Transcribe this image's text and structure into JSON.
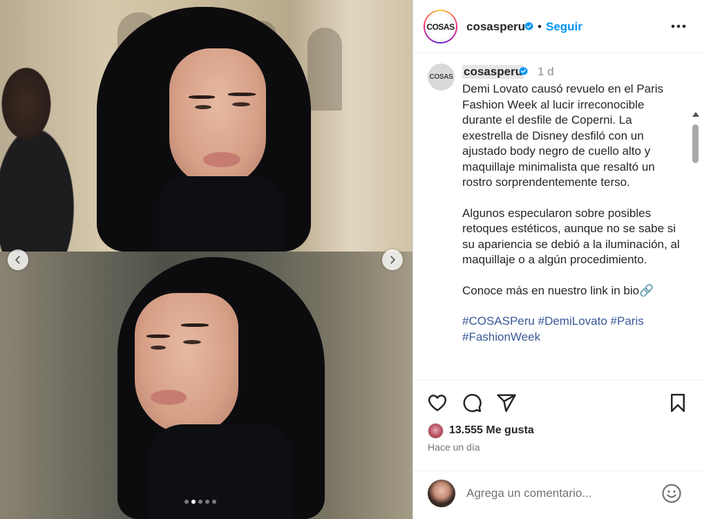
{
  "post": {
    "username": "cosasperu",
    "avatar_text": "COSAS",
    "verified_icon": "verified-badge-icon",
    "separator": "•",
    "follow_label": "Seguir",
    "more_icon": "more-horizontal-icon"
  },
  "media": {
    "carousel_total": 5,
    "carousel_active": 2,
    "prev_icon": "chevron-left-icon",
    "next_icon": "chevron-right-icon"
  },
  "caption": {
    "username": "cosasperu",
    "avatar_text": "COSAS",
    "time": "1 d",
    "paragraph1": "Demi Lovato causó revuelo en el Paris Fashion Week al lucir irreconocible durante el desfile de Coperni. La exestrella de Disney desfiló con un ajustado body negro de cuello alto y maquillaje minimalista que resaltó un rostro sorprendentemente terso.",
    "paragraph2": "Algunos especularon sobre posibles retoques estéticos, aunque no se sabe si su apariencia se debió a la iluminación, al maquillaje o a algún procedimiento.",
    "paragraph3": "Conoce más en nuestro link in bio",
    "link_emoji": "🔗",
    "hashtags": [
      "#COSASPeru",
      "#DemiLovato",
      "#Paris",
      "#FashionWeek"
    ]
  },
  "actions": {
    "like_icon": "heart-icon",
    "comment_icon": "comment-icon",
    "share_icon": "send-icon",
    "save_icon": "bookmark-icon",
    "likes_text": "13.555 Me gusta",
    "time_ago": "Hace un día"
  },
  "comment": {
    "placeholder": "Agrega un comentario...",
    "emoji_icon": "smiley-icon"
  },
  "colors": {
    "follow_blue": "#0095f6",
    "hashtag_blue": "#385898",
    "text": "#262626",
    "muted": "#737373"
  }
}
